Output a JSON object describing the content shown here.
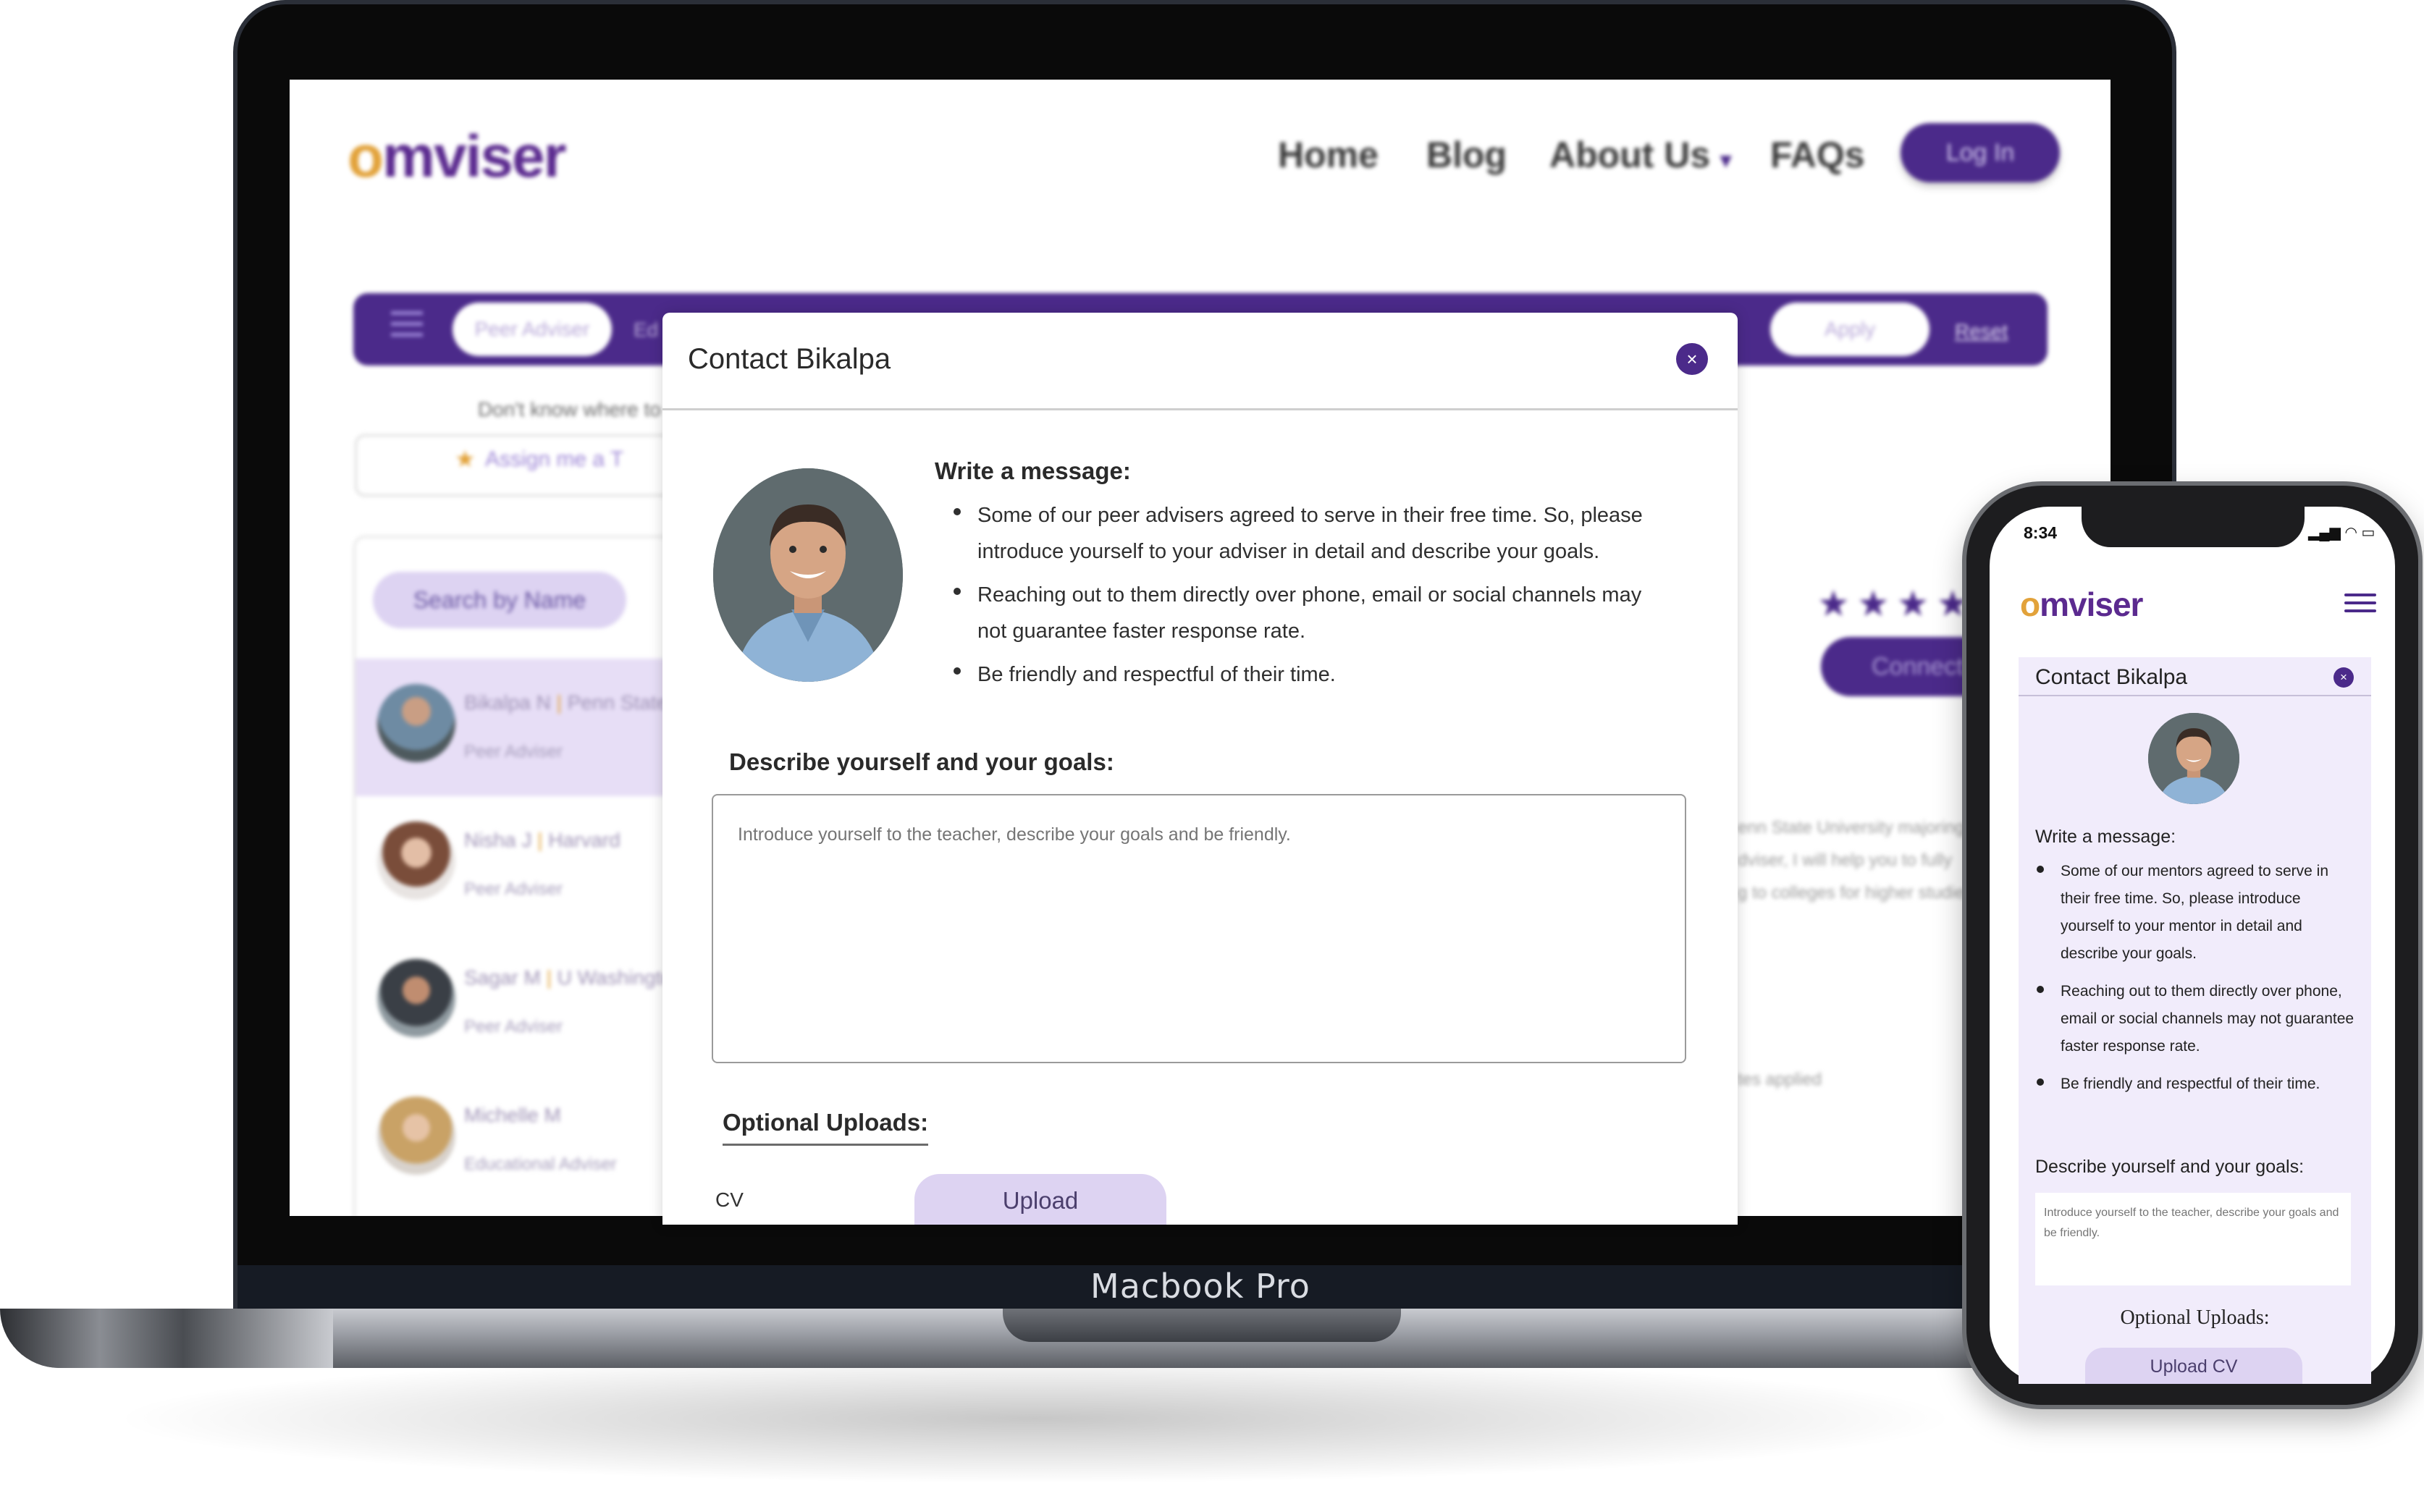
{
  "device_label": "Macbook Pro",
  "site": {
    "logo": {
      "accent": "o",
      "rest": "mviser"
    },
    "nav": [
      "Home",
      "Blog",
      "About Us",
      "FAQs"
    ],
    "about_caret": "▾",
    "login_label": "Log In",
    "filter": {
      "peer_adviser_tab": "Peer Adviser",
      "second_tab_partial": "Ed",
      "apply_label": "Apply",
      "reset_label": "Reset"
    },
    "dont_know_text": "Don't know where to",
    "assign_text": "Assign me a T",
    "search_placeholder": "Search by Name",
    "advisers": [
      {
        "name": "Bikalpa N",
        "school": "Penn State",
        "role": "Peer Adviser"
      },
      {
        "name": "Nisha J",
        "school": "Harvard",
        "role": "Peer Adviser"
      },
      {
        "name": "Sagar M",
        "school": "U Washingto",
        "role": "Peer Adviser"
      },
      {
        "name": "Michelle M",
        "school": "",
        "role": "Educational Adviser"
      }
    ],
    "stars": "★★★★",
    "connect_label": "Connect",
    "bio_lines": [
      "enn State University majoring i",
      "dviser, I will help you to fully",
      "g to colleges for higher studies",
      "tes applied"
    ]
  },
  "modal": {
    "title": "Contact Bikalpa",
    "close_icon": "×",
    "write_label": "Write a message:",
    "bullets": [
      "Some of our peer advisers agreed to serve in their free time. So, please introduce yourself to your adviser in detail and describe your goals.",
      "Reaching out to them directly over phone, email or social channels may not guarantee faster response rate.",
      "Be friendly and respectful of their time."
    ],
    "describe_label": "Describe yourself and your goals:",
    "message_placeholder": "Introduce yourself to the teacher, describe your goals and be friendly.",
    "optional_label": "Optional Uploads:",
    "cv_label": "CV",
    "upload_label": "Upload"
  },
  "phone": {
    "time": "8:34",
    "status_icons": "▂▄▆ ◠ ▭",
    "logo": {
      "accent": "o",
      "rest": "mviser"
    },
    "modal": {
      "title": "Contact Bikalpa",
      "close_icon": "×",
      "write_label": "Write a message:",
      "bullets": [
        "Some of our mentors agreed to serve in their free time. So, please introduce yourself to your mentor in detail and describe your goals.",
        "Reaching out to them directly over phone, email or social channels may not guarantee faster response rate.",
        "Be friendly and respectful of their time."
      ],
      "describe_label": "Describe yourself and your goals:",
      "message_placeholder": "Introduce yourself to the teacher, describe your goals and be friendly.",
      "optional_label": "Optional Uploads:",
      "upload_label": "Upload CV"
    }
  },
  "colors": {
    "brand_purple": "#4b2a8a",
    "brand_orange": "#e2a23a",
    "lavender": "#ddd3f2",
    "panel_lavender": "#f1ecfb"
  }
}
